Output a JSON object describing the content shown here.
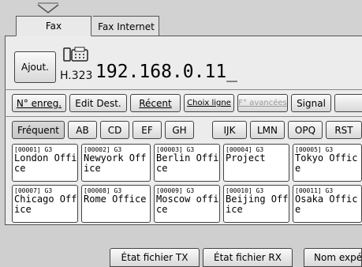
{
  "tabs": [
    {
      "label": "Fax"
    },
    {
      "label": "Fax Internet"
    }
  ],
  "add_button": {
    "label": "Ajout."
  },
  "protocol": {
    "label": "H.323"
  },
  "address": {
    "value": "192.168.0.11_"
  },
  "toolbar": [
    {
      "label": "N° enreg."
    },
    {
      "label": "Edit Dest."
    },
    {
      "label": "Récent"
    },
    {
      "label": "Choix ligne"
    },
    {
      "label": "F° avancées"
    },
    {
      "label": "Signal"
    }
  ],
  "index_tabs": [
    {
      "label": "Fréquent"
    },
    {
      "label": "AB"
    },
    {
      "label": "CD"
    },
    {
      "label": "EF"
    },
    {
      "label": "GH"
    },
    {
      "label": "IJK"
    },
    {
      "label": "LMN"
    },
    {
      "label": "OPQ"
    },
    {
      "label": "RST"
    }
  ],
  "destinations": [
    {
      "num": "[00001] G3",
      "name": "London Office"
    },
    {
      "num": "[00002] G3",
      "name": "Newyork Office"
    },
    {
      "num": "[00003] G3",
      "name": "Berlin Office"
    },
    {
      "num": "[00004] G3",
      "name": "Project"
    },
    {
      "num": "[00005] G3",
      "name": "Tokyo Office"
    },
    {
      "num": "[00007] G3",
      "name": "Chicago Office"
    },
    {
      "num": "[00008] G3",
      "name": "Rome Office"
    },
    {
      "num": "[00009] G3",
      "name": "Moscow office"
    },
    {
      "num": "[00010] G3",
      "name": "Beijing Office"
    },
    {
      "num": "[00011] G3",
      "name": "Osaka Office"
    }
  ],
  "bottom_buttons": [
    {
      "label": "État fichier TX"
    },
    {
      "label": "État fichier RX"
    },
    {
      "label": "Nom expéditeur"
    }
  ]
}
